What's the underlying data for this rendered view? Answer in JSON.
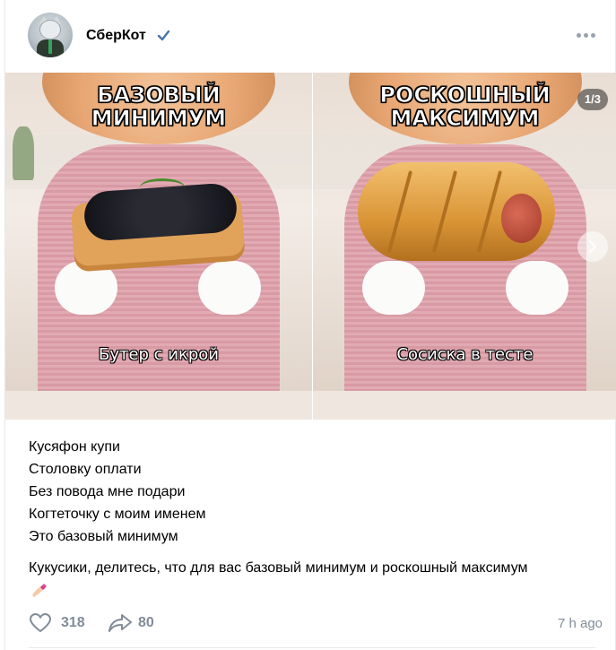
{
  "post": {
    "author": "СберКот",
    "verified_icon": "verified-check-icon",
    "more_icon": "more-dots-icon",
    "carousel": {
      "counter": "1/3",
      "slides": [
        {
          "title_line1": "БАЗОВЫЙ",
          "title_line2": "МИНИМУМ",
          "caption": "Бутер с икрой"
        },
        {
          "title_line1": "РОСКОШНЫЙ",
          "title_line2": "МАКСИМУМ",
          "caption": "Сосиска в тесте"
        }
      ],
      "next_icon": "chevron-right-icon"
    },
    "text_lines": [
      "Кусяфон купи",
      "Столовку оплати",
      "Без повода мне подари",
      "Когтеточку с моим именем",
      "Это базовый минимум"
    ],
    "question": "Кукусики, делитесь, что для вас базовый минимум и роскошный максимум",
    "emoji": "💅",
    "likes": "318",
    "shares": "80",
    "time": "7 h ago"
  },
  "colors": {
    "accent": "#2a5885",
    "verified": "#4a76a8",
    "meta": "#818c99"
  }
}
